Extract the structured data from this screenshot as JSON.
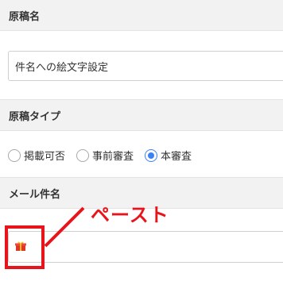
{
  "sections": {
    "title_header": "原稿名",
    "title_value": "件名への絵文字設定",
    "type_header": "原稿タイプ",
    "type_options": [
      "掲載可否",
      "事前審査",
      "本審査"
    ],
    "type_selected": "本審査",
    "subject_header": "メール件名",
    "subject_icon": "gift-emoji-icon"
  },
  "annotation": {
    "label": "ペースト",
    "color": "#e8141c"
  },
  "colors": {
    "accent": "#3b82f6",
    "header_bg": "#f2f2f2",
    "annotation": "#e8141c"
  }
}
